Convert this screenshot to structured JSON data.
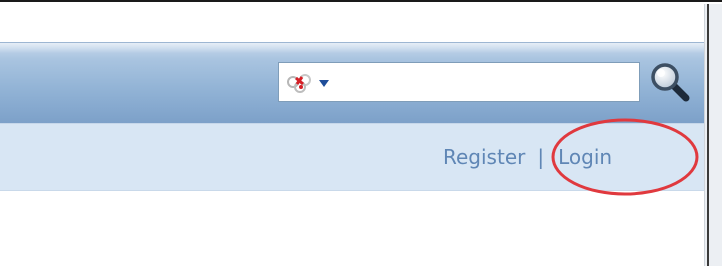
{
  "header": {
    "search": {
      "value": "",
      "placeholder": "",
      "engine_icon": "search-engine-logo-icon",
      "dropdown_icon": "caret-down-icon",
      "submit_icon": "magnifier-icon"
    }
  },
  "user_links": {
    "register_label": "Register",
    "separator": "|",
    "login_label": "Login"
  },
  "annotation": {
    "highlight_color": "#e0393e",
    "highlighted_item": "login-link"
  },
  "colors": {
    "header_bar": "#93b4d6",
    "subbar": "#d8e6f4",
    "link": "#5f86b5"
  }
}
